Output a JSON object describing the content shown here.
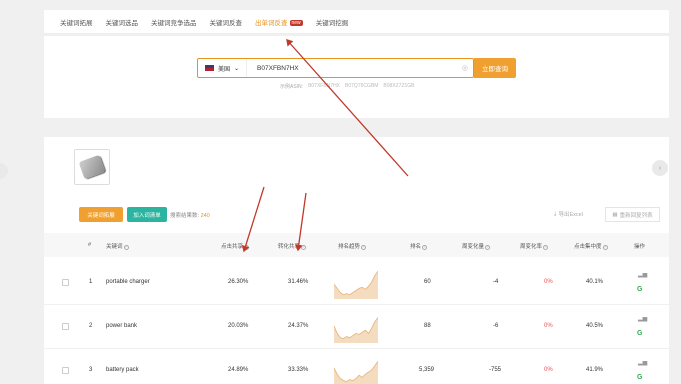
{
  "tabs": [
    {
      "label": "关键词拓展"
    },
    {
      "label": "关键词选品"
    },
    {
      "label": "关键词竞争选品"
    },
    {
      "label": "关键词反查"
    },
    {
      "label": "出单词反查",
      "badge": "new",
      "active": true
    },
    {
      "label": "关键词挖掘"
    }
  ],
  "search": {
    "market": "美国",
    "value": "B07XFBN7HX",
    "button": "立即查询",
    "examples_label": "示例ASIN:",
    "examples": [
      "B07XFBN7HX",
      "B07Q76CGBM",
      "B08XZ7Z1GB"
    ]
  },
  "toolbar": {
    "keyword_button": "关键词拓展",
    "add_button": "加入词清单",
    "result_label": "搜索结果数:",
    "result_count": "240",
    "export": "导出Excel",
    "restore": "重新回复列表"
  },
  "table": {
    "headers": {
      "index": "#",
      "keyword": "关键词",
      "click_share": "点击共享",
      "conversion_share": "转化共享",
      "rank_trend": "排名趋势",
      "rank": "排名",
      "weekly_change": "周变化量",
      "weekly_rate": "周变化率",
      "click_concentration": "点击集中度",
      "actions": "操作"
    },
    "rows": [
      {
        "index": "1",
        "keyword": "portable charger",
        "click_share": "26.30%",
        "conversion_share": "31.46%",
        "rank": "60",
        "weekly_change": "-4",
        "weekly_rate": "0%",
        "click_concentration": "40.1%",
        "trend": [
          14,
          10,
          6,
          4,
          5,
          4,
          6,
          8,
          10,
          11,
          9,
          12,
          16,
          22,
          26
        ]
      },
      {
        "index": "2",
        "keyword": "power bank",
        "click_share": "20.03%",
        "conversion_share": "24.37%",
        "rank": "88",
        "weekly_change": "-6",
        "weekly_rate": "0%",
        "click_concentration": "40.5%",
        "trend": [
          16,
          9,
          5,
          4,
          6,
          5,
          7,
          9,
          8,
          10,
          12,
          9,
          14,
          20,
          24
        ]
      },
      {
        "index": "3",
        "keyword": "battery pack",
        "click_share": "24.89%",
        "conversion_share": "33.33%",
        "rank": "5,359",
        "weekly_change": "-755",
        "weekly_rate": "0%",
        "click_concentration": "41.9%",
        "trend": [
          18,
          12,
          8,
          6,
          5,
          7,
          6,
          8,
          11,
          9,
          12,
          14,
          16,
          20,
          24
        ]
      }
    ]
  },
  "colors": {
    "accent": "#e8931d",
    "teal": "#2bb5a0",
    "arrow": "#c0392b",
    "negative": "#e85454"
  }
}
